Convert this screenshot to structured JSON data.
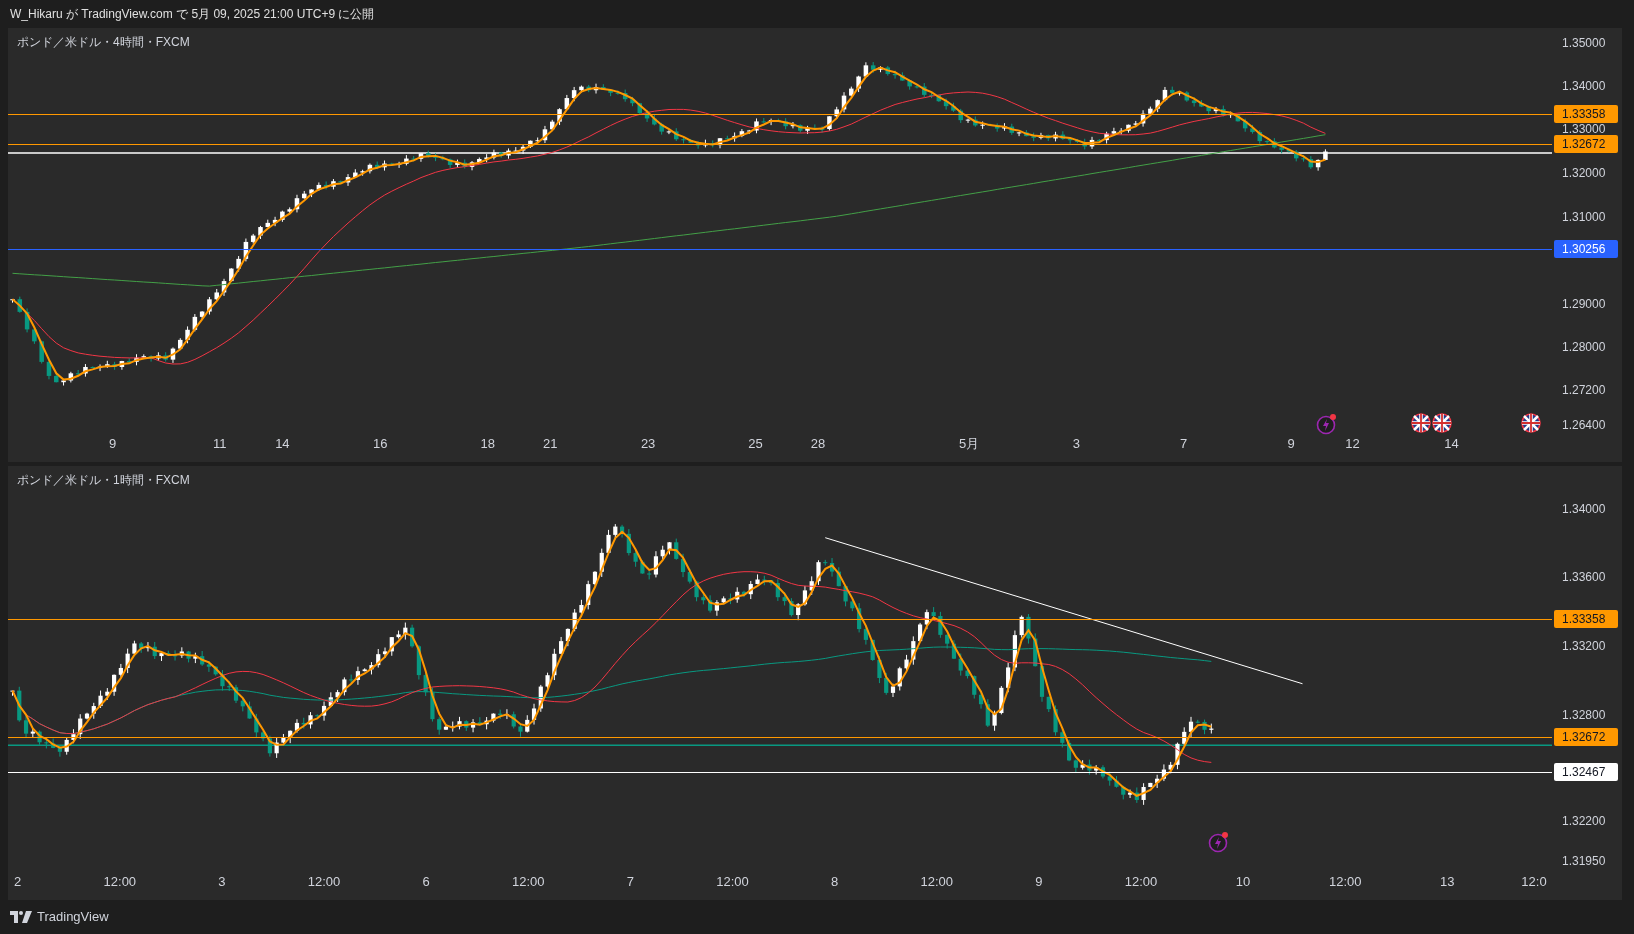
{
  "header": {
    "text": "W_Hikaru が TradingView.com で 5月 09, 2025 21:00 UTC+9 に公開"
  },
  "panels": [
    {
      "title": "ポンド／米ドル・4時間・FXCM",
      "price_axis": [
        "1.35000",
        "1.34000",
        "1.33000",
        "1.32000",
        "1.31000",
        "1.29000",
        "1.28000",
        "1.27200",
        "1.26400"
      ],
      "price_tags": [
        {
          "text": "1.33358",
          "color": "#ff9800"
        },
        {
          "text": "1.32672",
          "color": "#ff9800"
        },
        {
          "text": "1.30256",
          "color": "#2962ff"
        }
      ],
      "time_axis": [
        "9",
        "11",
        "14",
        "16",
        "18",
        "21",
        "23",
        "25",
        "28",
        "5月",
        "3",
        "7",
        "9",
        "12",
        "14"
      ]
    },
    {
      "title": "ポンド／米ドル・1時間・FXCM",
      "price_axis": [
        "1.34000",
        "1.33600",
        "1.33200",
        "1.32800",
        "1.32200",
        "1.31950"
      ],
      "price_tags": [
        {
          "text": "1.33358",
          "color": "#ff9800"
        },
        {
          "text": "1.32672",
          "color": "#ff9800"
        },
        {
          "text": "1.32467",
          "color": "#ffffff"
        }
      ],
      "time_axis": [
        "2",
        "12:00",
        "3",
        "12:00",
        "6",
        "12:00",
        "7",
        "12:00",
        "8",
        "12:00",
        "9",
        "12:00",
        "10",
        "12:00",
        "13",
        "12:0"
      ]
    }
  ],
  "footer": {
    "brand": "TradingView"
  }
}
